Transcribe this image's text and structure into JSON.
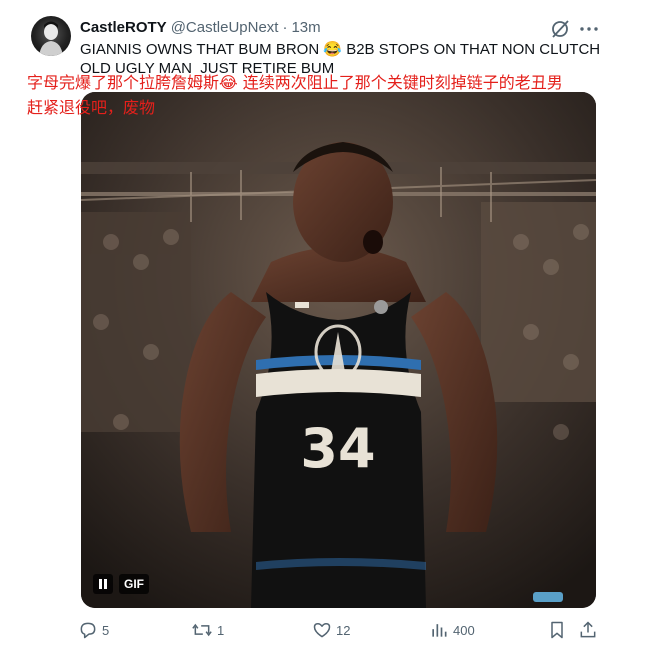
{
  "author": {
    "name": "CastleROTY",
    "handle": "@CastleUpNext",
    "separator": "·",
    "time": "13m"
  },
  "tweet": {
    "text": "GIANNIS OWNS THAT BUM BRON 😂 B2B STOPS ON THAT NON CLUTCH\nOLD UGLY MAN  JUST RETIRE BUM"
  },
  "translation": {
    "text": "字母完爆了那个拉胯詹姆斯😂 连续两次阻止了那个关键时刻掉链子的老丑男\n赶紧退役吧，废物",
    "color": "#e4201b"
  },
  "media": {
    "gif_label": "GIF",
    "jersey_number": "34",
    "jersey_color": "#111111",
    "stripe_color": "#2f6fb0"
  },
  "actions": {
    "replies": "5",
    "reposts": "1",
    "likes": "12",
    "views": "400"
  },
  "icons": [
    "grok-icon",
    "more-icon",
    "reply-icon",
    "repost-icon",
    "like-icon",
    "views-icon",
    "bookmark-icon",
    "share-icon",
    "pause-icon"
  ]
}
